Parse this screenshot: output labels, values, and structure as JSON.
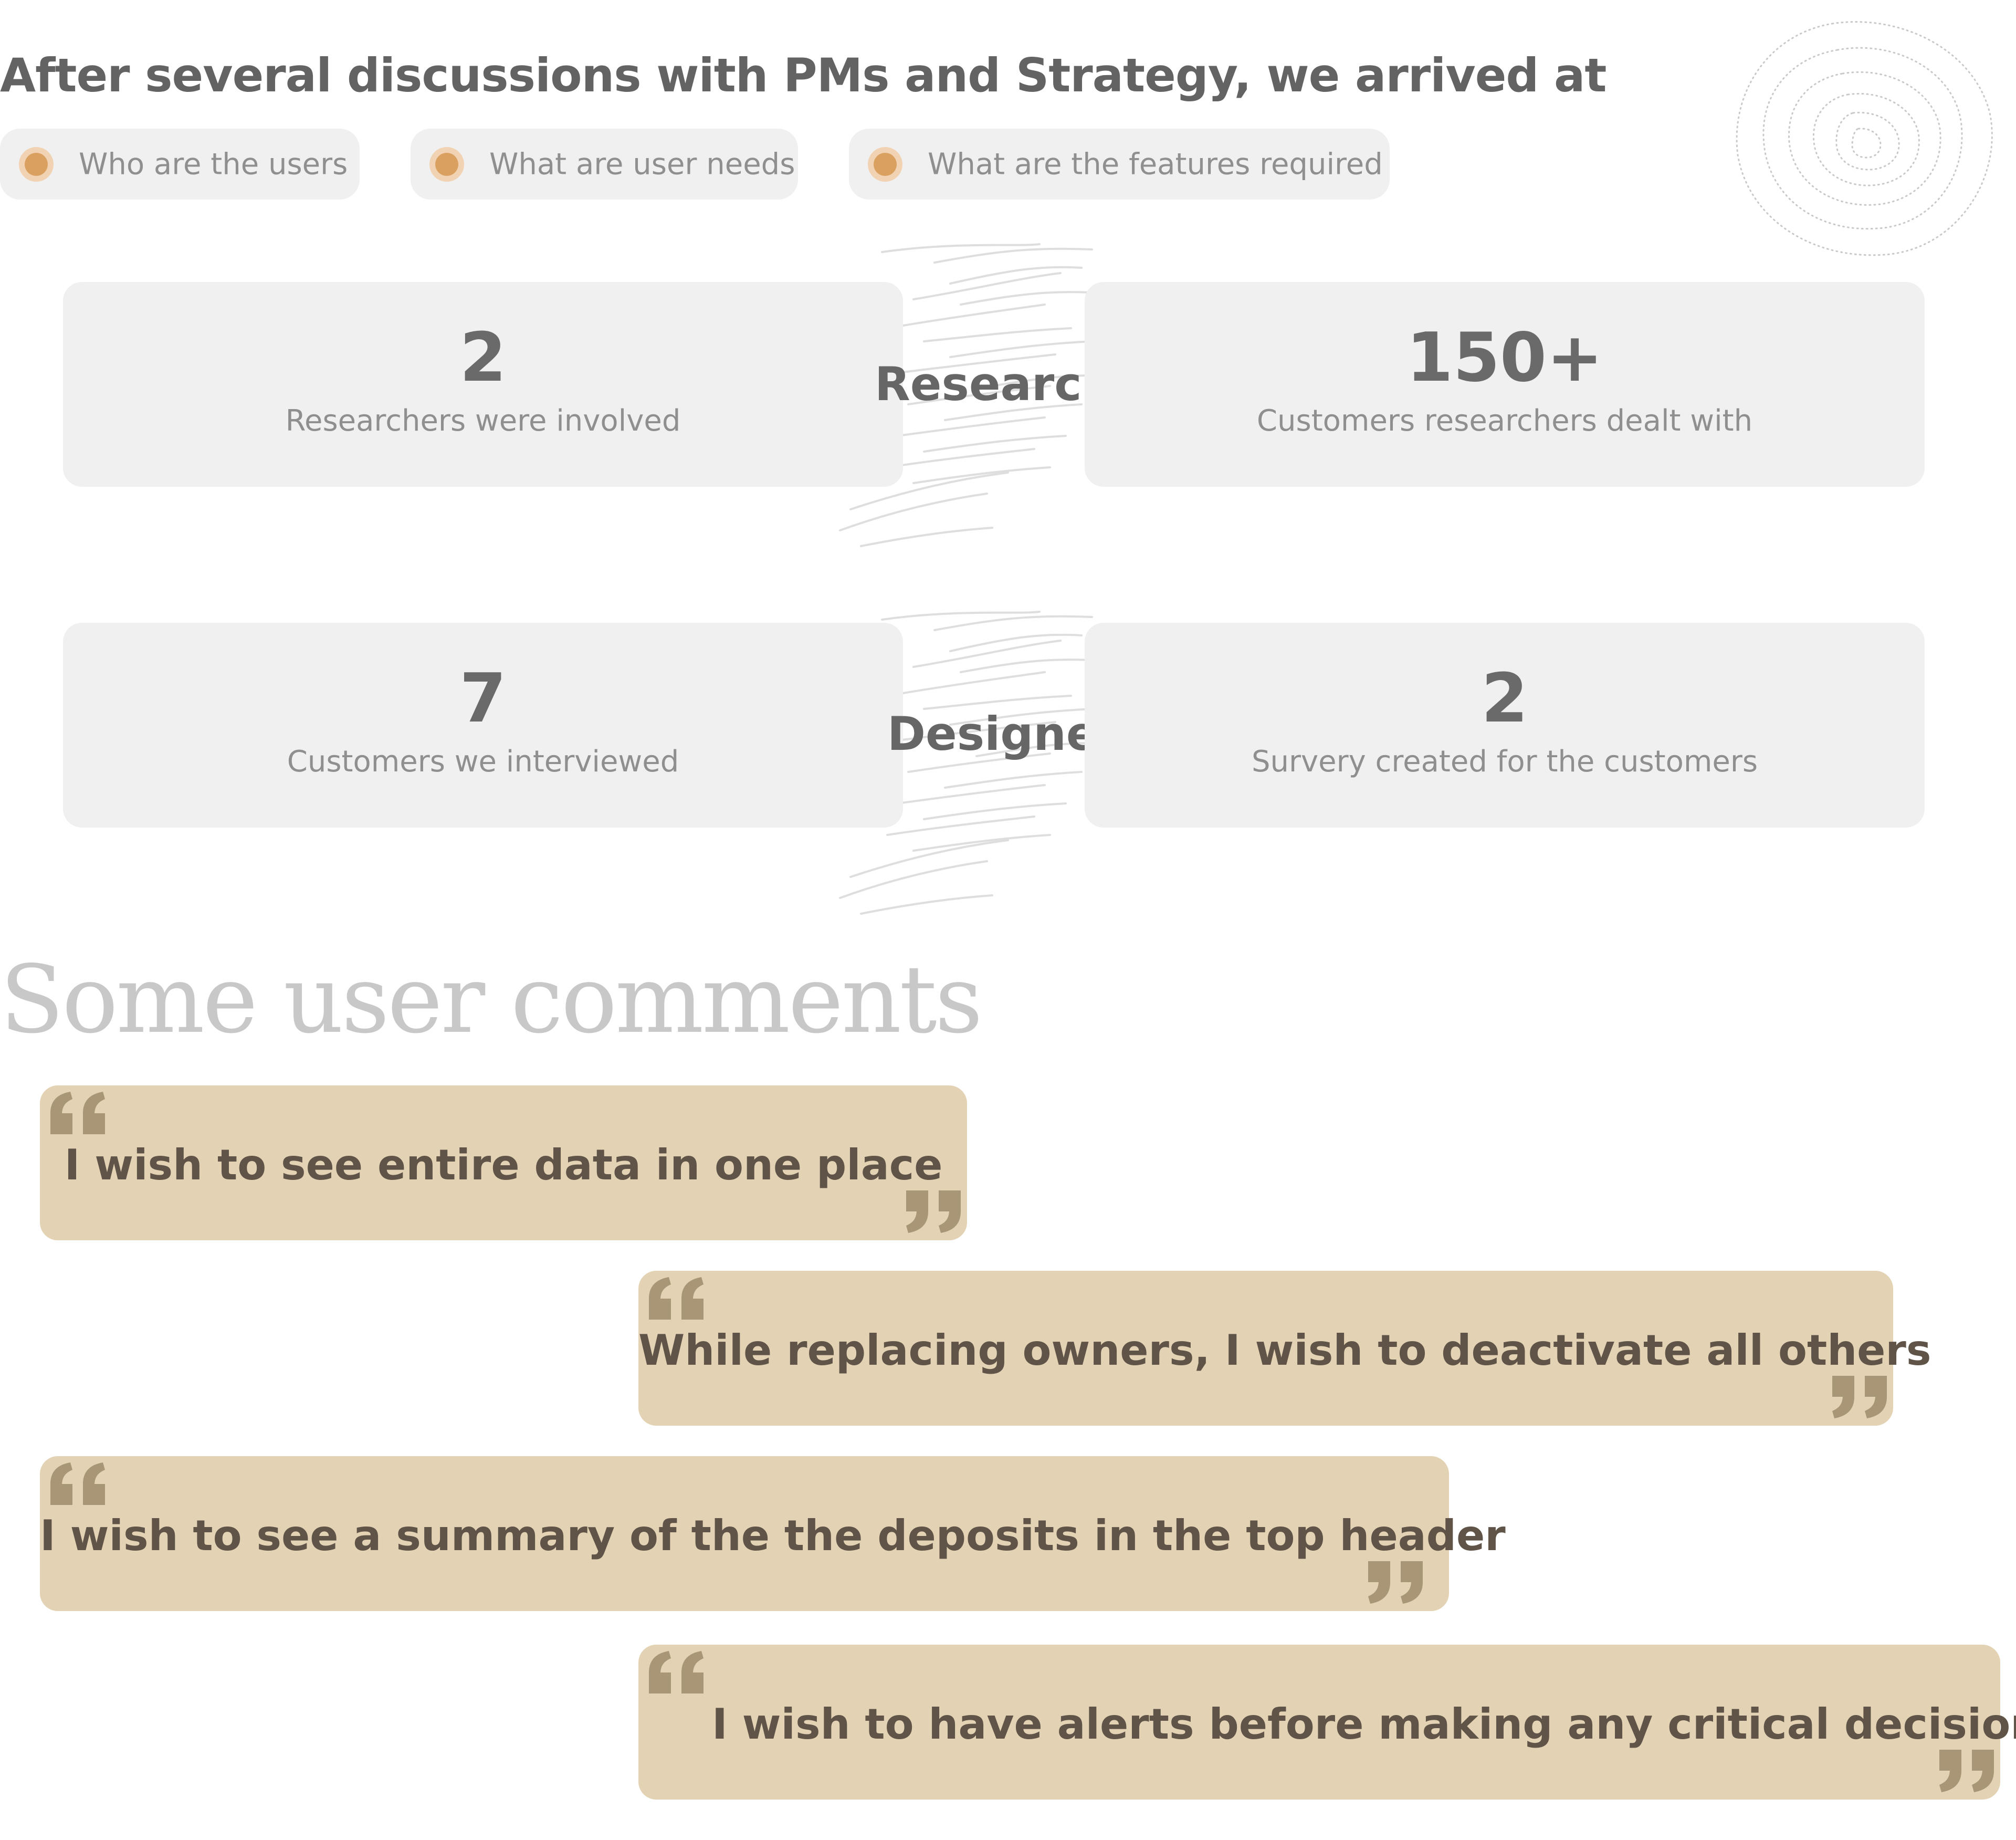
{
  "heading": "After several discussions with PMs and Strategy, we arrived at",
  "pills": [
    {
      "label": "Who are the users"
    },
    {
      "label": "What are user needs"
    },
    {
      "label": "What are the features required"
    }
  ],
  "stats": {
    "researchers": {
      "role_label": "Researchers",
      "left": {
        "value": "2",
        "label": "Researchers were involved"
      },
      "right": {
        "value": "150+",
        "label": "Customers researchers dealt with"
      }
    },
    "designers": {
      "role_label": "Designers",
      "left": {
        "value": "7",
        "label": "Customers we interviewed"
      },
      "right": {
        "value": "2",
        "label": "Survery created for the customers"
      }
    }
  },
  "comments_title": "Some user comments",
  "comments": [
    {
      "text": "I wish to see entire  data in one place"
    },
    {
      "text": "While replacing owners, I wish to deactivate all others"
    },
    {
      "text": "I wish to see a summary of the the deposits in the top header"
    },
    {
      "text": "I wish to have alerts before making any critical decision"
    }
  ],
  "colors": {
    "card_background": "#f0f0f0",
    "quote_background": "#e3d3b4",
    "quote_mark": "#a89676",
    "accent_dot": "#d9a060"
  }
}
